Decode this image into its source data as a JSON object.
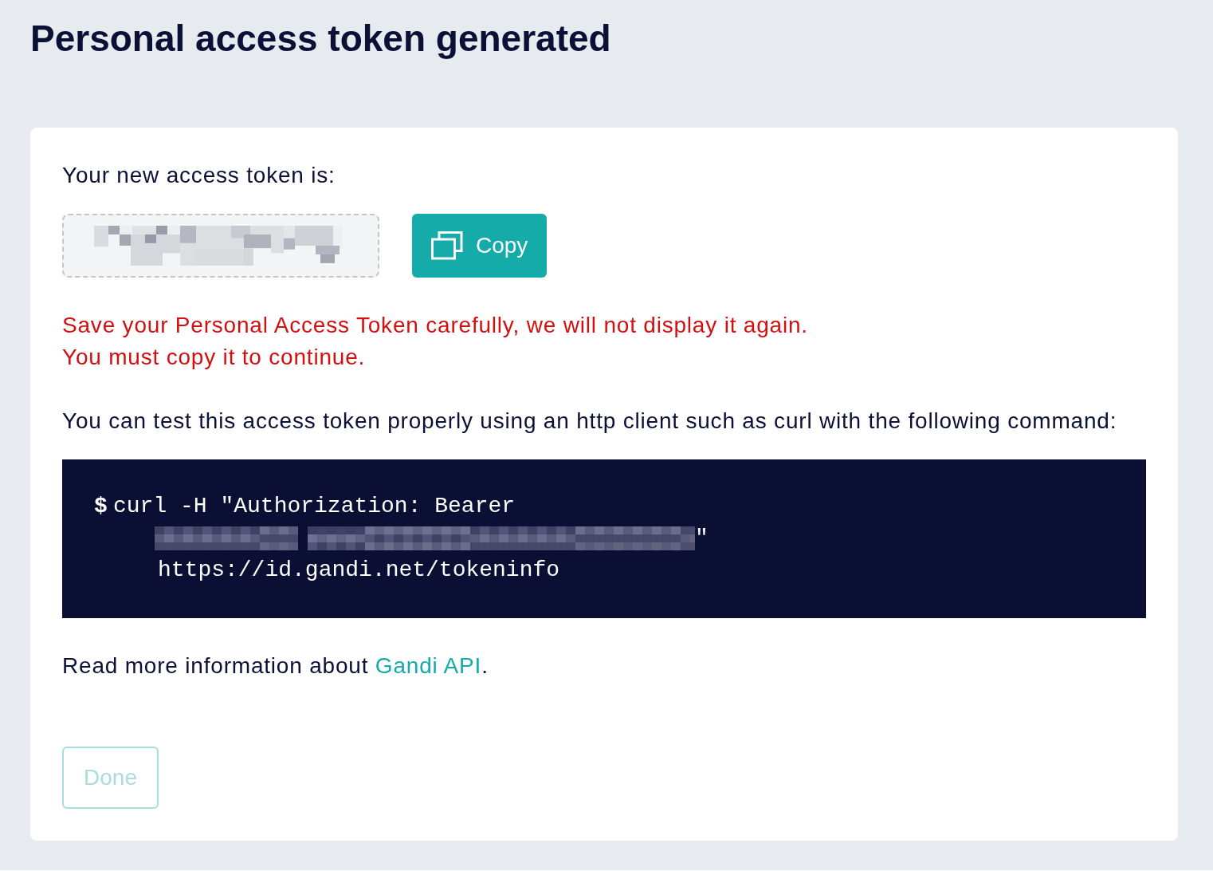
{
  "page": {
    "title": "Personal access token generated"
  },
  "card": {
    "intro": "Your new access token is:",
    "token_field": {
      "redacted": true
    },
    "copy_button": {
      "label": "Copy"
    },
    "warnings": [
      "Save your Personal Access Token carefully, we will not display it again.",
      "You must copy it to continue."
    ],
    "test_hint": "You can test this access token properly using an http client such as curl with the following command:",
    "code": {
      "prompt": "$",
      "lines": [
        {
          "kind": "text",
          "text": "curl -H \"Authorization: Bearer"
        },
        {
          "kind": "redacted",
          "suffix": "\""
        },
        {
          "kind": "text",
          "text": "https://id.gandi.net/tokeninfo"
        }
      ]
    },
    "more_info": {
      "text": "Read more information about ",
      "link": "Gandi API",
      "after": "."
    },
    "done_button": {
      "label": "Done",
      "disabled": true
    }
  }
}
